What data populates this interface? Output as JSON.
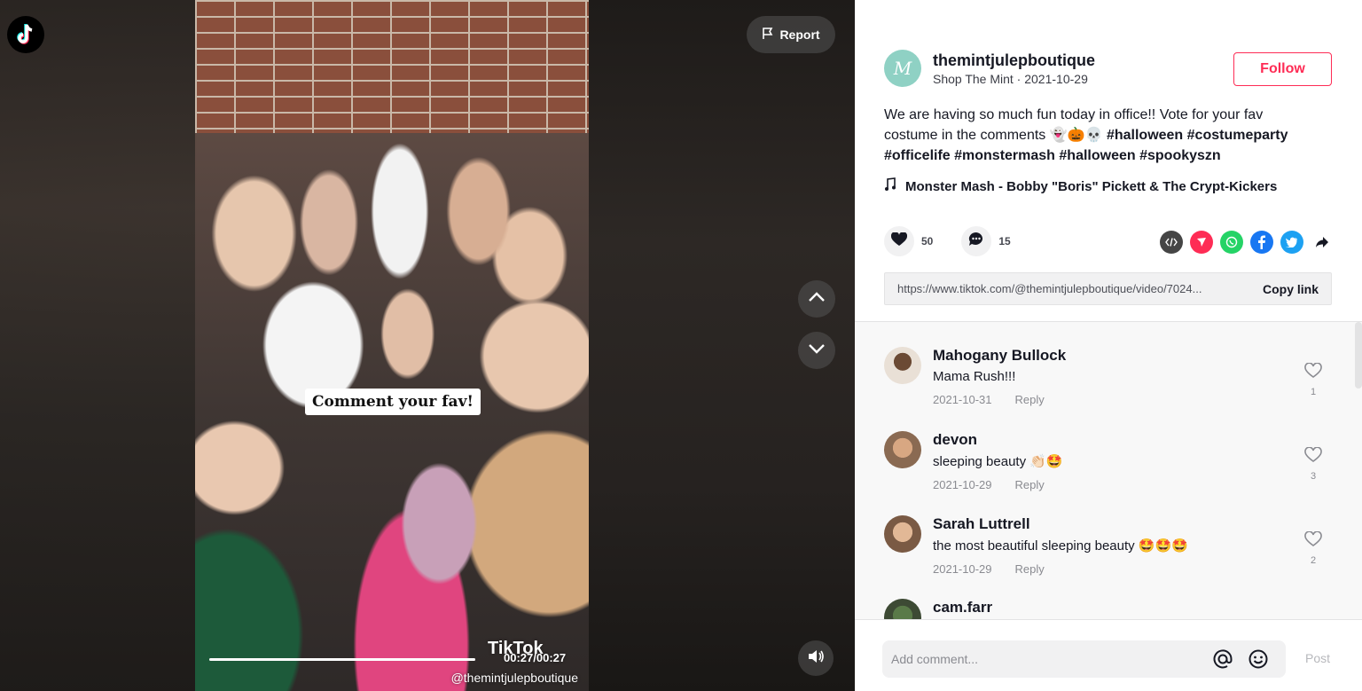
{
  "report": {
    "label": "Report"
  },
  "video": {
    "caption_sticker": "Comment your fav!",
    "watermark_logo": "TikTok",
    "watermark_user": "@themintjulepboutique",
    "time": "00:27/00:27",
    "progress": 1.0
  },
  "author": {
    "name": "themintjulepboutique",
    "subtitle": "Shop The Mint · 2021-10-29",
    "avatar_letter": "M",
    "follow_label": "Follow"
  },
  "post": {
    "description_plain": "We are having so much fun today in office!! Vote for your fav costume in the comments 👻🎃💀 ",
    "description_tags": "#halloween #costumeparty #officelife #monstermash #halloween #spookyszn",
    "music": "Monster Mash - Bobby \"Boris\" Pickett & The Crypt-Kickers",
    "likes": "50",
    "comments": "15",
    "link_url": "https://www.tiktok.com/@themintjulepboutique/video/7024...",
    "copy_link_label": "Copy link"
  },
  "comments": [
    {
      "name": "Mahogany Bullock",
      "text": "Mama Rush!!!",
      "date": "2021-10-31",
      "reply": "Reply",
      "likes": "1"
    },
    {
      "name": "devon",
      "text": "sleeping beauty 👏🏻🤩",
      "date": "2021-10-29",
      "reply": "Reply",
      "likes": "3"
    },
    {
      "name": "Sarah Luttrell",
      "text": "the most beautiful sleeping beauty 🤩🤩🤩",
      "date": "2021-10-29",
      "reply": "Reply",
      "likes": "2"
    },
    {
      "name": "cam.farr"
    }
  ],
  "comment_bar": {
    "placeholder": "Add comment...",
    "post_label": "Post"
  },
  "colors": {
    "accent": "#fe2c55",
    "avatar_mint": "#8fd1c4"
  },
  "icons": [
    "tiktok-logo-icon",
    "flag-icon",
    "chevron-up-icon",
    "chevron-down-icon",
    "volume-icon",
    "music-note-icon",
    "heart-icon",
    "comment-icon",
    "embed-icon",
    "send-icon",
    "whatsapp-icon",
    "facebook-icon",
    "twitter-icon",
    "share-arrow-icon",
    "at-icon",
    "emoji-icon"
  ]
}
